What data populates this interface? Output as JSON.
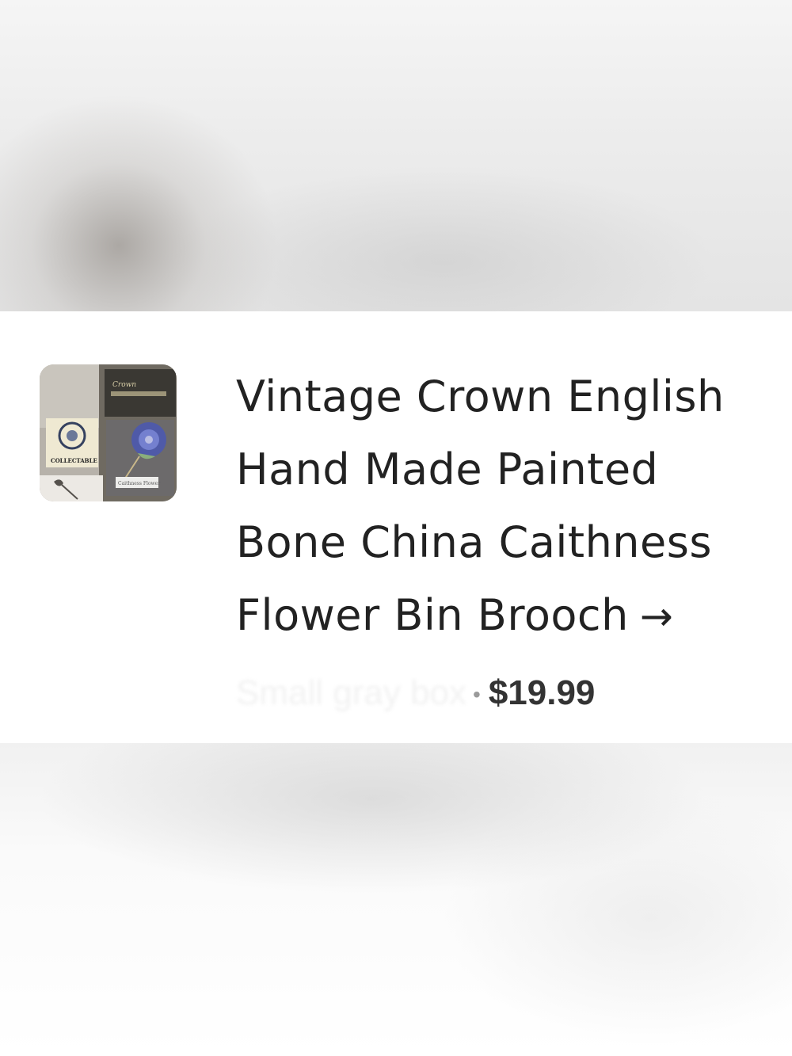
{
  "listing": {
    "title": "Vintage Crown English Hand Made Painted Bone China Caithness Flower Bin Brooch",
    "arrow_icon": "arrow-right-icon",
    "subtitle_faded": "Small gray box",
    "separator": "•",
    "price": "$19.99",
    "thumbnail_icon": "product-photo-brooch",
    "thumbnail_text": {
      "tag": "COLLECTABLE",
      "card": "Caithness Flower"
    }
  },
  "colors": {
    "title_text": "#222222",
    "price_text": "#333333",
    "card_background": "#ffffff"
  }
}
